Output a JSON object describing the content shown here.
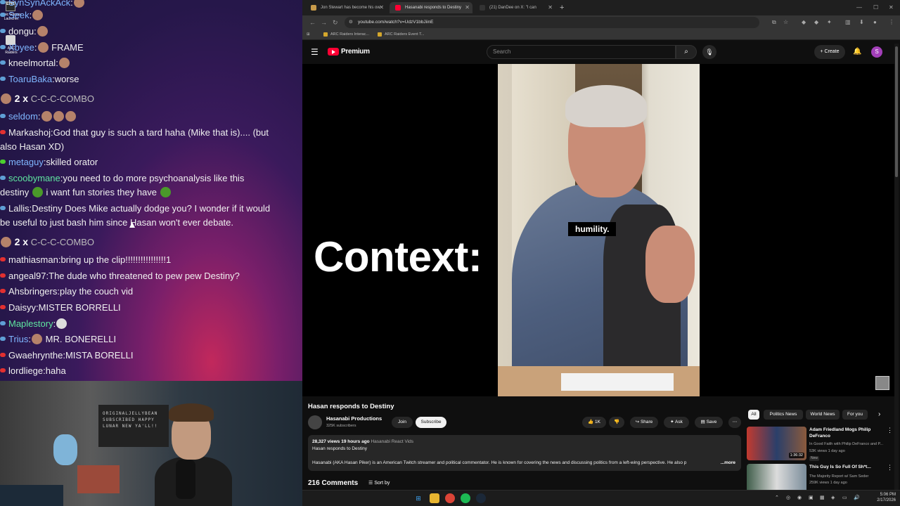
{
  "desktop": {
    "epic_games_label": "Epic Games Launcher",
    "arc_raiders_label": "ARC Raiders"
  },
  "chat": {
    "messages": [
      {
        "user": "SynSynAckAck",
        "text": "",
        "user_color": "#7fb6ff",
        "dot_color": "#5f9fd5"
      },
      {
        "user": "Seek",
        "text": "",
        "user_color": "#7fb6ff",
        "dot_color": "#5f9fd5"
      },
      {
        "user": "dongu",
        "text": "",
        "user_color": "#f0f0f0",
        "dot_color": "#5f9fd5"
      },
      {
        "user": "Xbyee",
        "text": "FRAME",
        "user_color": "#7fb6ff",
        "dot_color": "#5f9fd5"
      },
      {
        "user": "kneelmortal",
        "text": "",
        "user_color": "#f0f0f0",
        "dot_color": "#5f9fd5"
      },
      {
        "user": "ToaruBaka",
        "text": "worse",
        "user_color": "#7fb6ff",
        "dot_color": "#5f9fd5"
      },
      {
        "user": "seldom",
        "text": "",
        "user_color": "#7fb6ff",
        "dot_color": "#5f9fd5"
      },
      {
        "user": "Markashoj",
        "text": "God that guy is such a tard haha (Mike that is).... (but",
        "text2": "also Hasan XD)",
        "user_color": "#f0f0f0",
        "dot_color": "#e23030"
      },
      {
        "user": "metaguy",
        "text": "skilled orator",
        "user_color": "#7fb6ff",
        "dot_color": "#4cd12f"
      },
      {
        "user": "scoobymane",
        "text": "you need to do more psychoanalysis like this",
        "text2a": "destiny",
        "text2b": "i want fun stories they have",
        "user_color": "#5fe6a0",
        "dot_color": "#5f9fd5"
      },
      {
        "user": "Lallis",
        "text": "Destiny Does Mike actually dodge you? I wonder if it would",
        "text2": "be useful to just bash him since Hasan won't ever debate.",
        "user_color": "#f0f0f0",
        "dot_color": "#5f9fd5"
      },
      {
        "user": "mathiasman",
        "text": "bring up the clip!!!!!!!!!!!!!!!!1",
        "user_color": "#f0f0f0",
        "dot_color": "#e23030"
      },
      {
        "user": "angeal97",
        "text": "The dude who threatened to pew pew Destiny?",
        "user_color": "#f0f0f0",
        "dot_color": "#e23030"
      },
      {
        "user": "Ahsbringers",
        "text": "play the couch vid",
        "user_color": "#f0f0f0",
        "dot_color": "#e23030"
      },
      {
        "user": "Daisyy",
        "text": "MISTER BORRELLI",
        "user_color": "#f0f0f0",
        "dot_color": "#e23030"
      },
      {
        "user": "Maplestory",
        "text": "",
        "user_color": "#5fe6a0",
        "dot_color": "#5f9fd5"
      },
      {
        "user": "Trius",
        "text": "MR. BONERELLI",
        "user_color": "#7fb6ff",
        "dot_color": "#5f9fd5"
      },
      {
        "user": "Gwaehrynthe",
        "text": "MISTA BORELLI",
        "user_color": "#f0f0f0",
        "dot_color": "#e23030"
      },
      {
        "user": "lordliege",
        "text": "haha",
        "user_color": "#f0f0f0",
        "dot_color": "#e23030"
      }
    ],
    "combo": {
      "count": "2 x",
      "label": "C-C-C-COMBO"
    }
  },
  "webcam": {
    "board_text": "ORIGINALJELLYBEAN SUBSCRIBED HAPPY LUNAR NEW YA'LL!!"
  },
  "browser": {
    "tabs": [
      {
        "title": "Jon Stewart has become his ow",
        "fav_color": "#c79b4a"
      },
      {
        "title": "Hasanabi responds to Destiny",
        "fav_color": "#ff0033"
      },
      {
        "title": "(21) DanDee on X: \"I can",
        "fav_color": "#333333"
      }
    ],
    "url": "youtube.com/watch?v=UdzV1bbJiinE",
    "bookmarks": [
      "ARC Raiders Interac...",
      "ARC Raiders Event T..."
    ]
  },
  "youtube": {
    "logo_text": "Premium",
    "search_placeholder": "Search",
    "create_label": "Create",
    "avatar_letter": "S",
    "video_overlay_text": "Context:",
    "subtitle": "humility.",
    "title": "Hasan responds to Destiny",
    "channel": "Hasanabi Productions",
    "subscribers": "325K subscribers",
    "join_label": "Join",
    "subscribe_label": "Subscribe",
    "like_count": "1K",
    "share_label": "Share",
    "ask_label": "Ask",
    "save_label": "Save",
    "views_date": "28,327 views  19 hours ago",
    "desc_tag": "Hasanabi React Vids",
    "desc_title": "Hasan responds to Destiny",
    "desc_body": "Hasanabi (AKA Hasan Piker) is an American Twitch streamer and political commentator. He is known for covering the news and discussing politics from a left-wing perspective. He also p",
    "desc_more": "...more",
    "comments_count": "216 Comments",
    "sort_label": "Sort by",
    "chips": [
      "All",
      "Politics News",
      "World News",
      "For you"
    ],
    "recommendations": [
      {
        "title": "Adam Friedland Mogs Philip DeFranco",
        "channel": "In Good Faith with Philip DeFranco and P...",
        "meta": "53K views  1 day ago",
        "badge": "New",
        "duration": "1:36:32"
      },
      {
        "title": "This Guy Is So Full Of Sh*t...",
        "channel": "The Majority Report w/ Sam Seder",
        "meta": "259K views  1 day ago",
        "badge": "",
        "duration": ""
      }
    ]
  },
  "taskbar": {
    "time": "5:06 PM",
    "date": "2/17/2026"
  }
}
